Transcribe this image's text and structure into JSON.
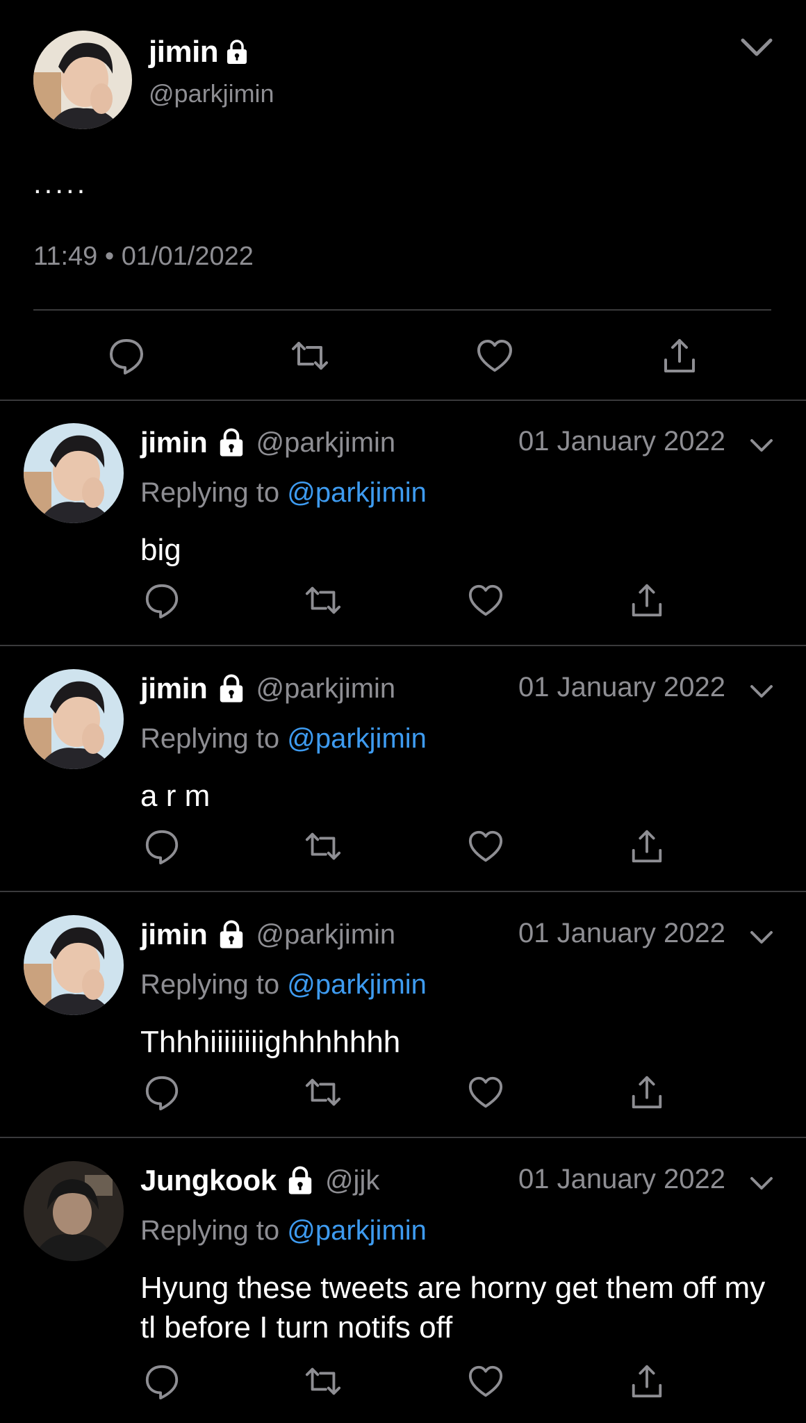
{
  "main_tweet": {
    "display_name": "jimin",
    "handle": "@parkjimin",
    "text": ".....",
    "timestamp": "11:49 • 01/01/2022",
    "icons": [
      "lock-icon",
      "chevron-down-icon",
      "reply-icon",
      "retweet-icon",
      "like-icon",
      "share-icon"
    ]
  },
  "replies": [
    {
      "display_name": "jimin",
      "handle": "@parkjimin",
      "date": "01 January 2022",
      "replying_label": "Replying to",
      "replying_to": "@parkjimin",
      "text": "big",
      "avatar": "jimin-avatar"
    },
    {
      "display_name": "jimin",
      "handle": "@parkjimin",
      "date": "01 January 2022",
      "replying_label": "Replying to",
      "replying_to": "@parkjimin",
      "text": "a r m",
      "avatar": "jimin-avatar"
    },
    {
      "display_name": "jimin",
      "handle": "@parkjimin",
      "date": "01 January 2022",
      "replying_label": "Replying to",
      "replying_to": "@parkjimin",
      "text": "Thhhiiiiiiiighhhhhhh",
      "avatar": "jimin-avatar"
    },
    {
      "display_name": "Jungkook",
      "handle": "@jjk",
      "date": "01 January 2022",
      "replying_label": "Replying to",
      "replying_to": "@parkjimin",
      "text": "Hyung these tweets are horny get them off my tl before I turn notifs off",
      "avatar": "jungkook-avatar"
    }
  ],
  "colors": {
    "background": "#000000",
    "text": "#ffffff",
    "secondary": "#8e8e93",
    "mention": "#3e9bf0",
    "divider": "#3a3a3c"
  }
}
